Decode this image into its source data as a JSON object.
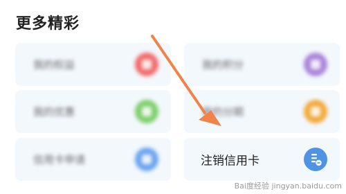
{
  "section": {
    "title": "更多精彩"
  },
  "cards": [
    {
      "label": "我的权益",
      "badge_color": "#f06a6a",
      "icon": "gift-icon"
    },
    {
      "label": "我的积分",
      "badge_color": "#a983d8",
      "icon": "points-icon"
    },
    {
      "label": "我的优惠",
      "badge_color": "#7dcf6a",
      "icon": "coupon-icon"
    },
    {
      "label": "我的分期",
      "badge_color": "#f2a93a",
      "icon": "installment-icon"
    },
    {
      "label": "信用卡申请",
      "badge_color": "#6aa3ee",
      "icon": "card-apply-icon"
    },
    {
      "label": "注销信用卡",
      "badge_color": "#4f94e4",
      "icon": "cancel-card-icon"
    }
  ],
  "annotation": {
    "arrow_color": "#f0824a",
    "target": "注销信用卡"
  },
  "watermark": {
    "text": "Bai度经验 jingyan.baidu.com"
  }
}
